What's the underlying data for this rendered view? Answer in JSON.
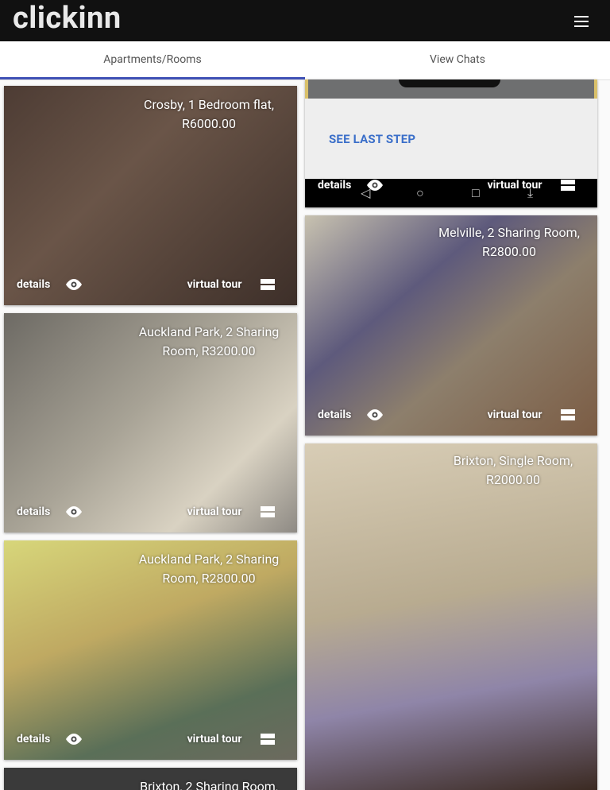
{
  "app": {
    "brand": "clickinn",
    "menu_icon": "hamburger-menu-icon"
  },
  "tabs": [
    {
      "label": "Apartments/Rooms",
      "active": true
    },
    {
      "label": "View Chats",
      "active": false
    }
  ],
  "colors": {
    "appbar": "#111111",
    "tab_indicator": "#3f51b5",
    "accent_link": "#3b6fc9"
  },
  "card_actions": {
    "details_label": "details",
    "details_icon": "eye-icon",
    "tour_label": "virtual tour",
    "tour_icon": "view-stream-icon"
  },
  "listings": [
    {
      "title": "Crosby, 1 Bedroom flat, R6000.00"
    },
    {
      "title": "Auckland Park, 2 Sharing Room, R3200.00"
    },
    {
      "title": "Auckland Park, 2 Sharing Room, R2800.00"
    },
    {
      "title": "Brixton, 2 Sharing Room,"
    },
    {
      "title": ""
    },
    {
      "title": "Melville, 2 Sharing Room, R2800.00"
    },
    {
      "title": "Brixton, Single Room, R2000.00"
    }
  ],
  "embedded_screenshot": {
    "button_text": "SEE LAST STEP",
    "nav_icons": [
      "back-triangle-icon",
      "home-circle-icon",
      "recents-square-icon",
      "download-arrow-icon"
    ]
  }
}
